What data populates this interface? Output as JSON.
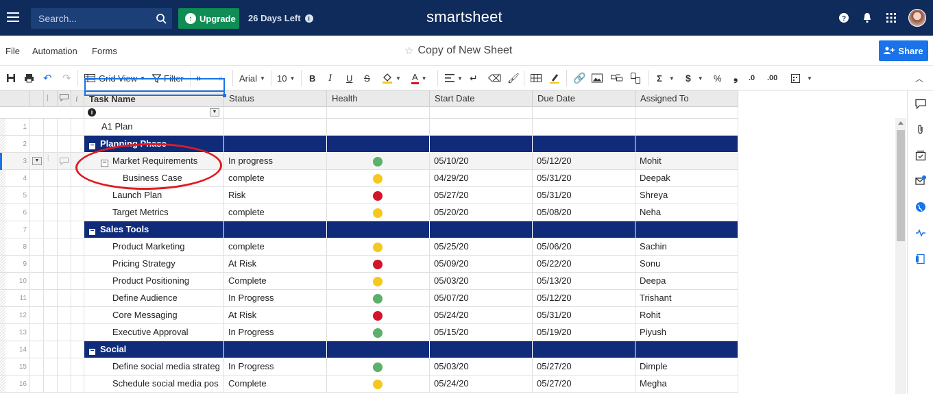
{
  "nav": {
    "search_placeholder": "Search...",
    "upgrade_label": "Upgrade",
    "days_left": "26 Days Left",
    "brand": "smartsheet"
  },
  "menu": {
    "file": "File",
    "automation": "Automation",
    "forms": "Forms",
    "sheet_title": "Copy of New Sheet",
    "share": "Share"
  },
  "toolbar": {
    "grid_view": "Grid View",
    "filter": "Filter",
    "font": "Arial",
    "font_size": "10",
    "bold": "B",
    "italic": "I",
    "underline": "U",
    "strike": "S",
    "text_color": "A",
    "sum": "Σ",
    "currency": "$",
    "percent": "%",
    "thousands": "❟",
    "dec_less": ".0",
    "dec_more": ".00"
  },
  "columns": [
    "Task Name",
    "Status",
    "Health",
    "Start Date",
    "Due Date",
    "Assigned To"
  ],
  "health_colors": {
    "green": "#5bb06a",
    "yellow": "#f5c81d",
    "red": "#d3142a"
  },
  "rows": [
    {
      "num": "1",
      "task": "A1 Plan",
      "status": "",
      "health": "",
      "start": "",
      "due": "",
      "assigned": ""
    },
    {
      "num": "2",
      "task": "Planning Phase",
      "group": true
    },
    {
      "num": "3",
      "task": "Market Requirements",
      "status": "In progress",
      "health": "green",
      "start": "05/10/20",
      "due": "05/12/20",
      "assigned": "Mohit"
    },
    {
      "num": "4",
      "task": "Business Case",
      "status": "complete",
      "health": "yellow",
      "start": "04/29/20",
      "due": "05/31/20",
      "assigned": "Deepak"
    },
    {
      "num": "5",
      "task": "Launch Plan",
      "status": "Risk",
      "health": "red",
      "start": "05/27/20",
      "due": "05/31/20",
      "assigned": "Shreya"
    },
    {
      "num": "6",
      "task": "Target Metrics",
      "status": "complete",
      "health": "yellow",
      "start": "05/20/20",
      "due": "05/08/20",
      "assigned": "Neha"
    },
    {
      "num": "7",
      "task": "Sales Tools",
      "group": true
    },
    {
      "num": "8",
      "task": "Product Marketing",
      "status": "complete",
      "health": "yellow",
      "start": "05/25/20",
      "due": "05/06/20",
      "assigned": "Sachin"
    },
    {
      "num": "9",
      "task": "Pricing Strategy",
      "status": "At Risk",
      "health": "red",
      "start": "05/09/20",
      "due": "05/22/20",
      "assigned": "Sonu"
    },
    {
      "num": "10",
      "task": "Product Positioning",
      "status": "Complete",
      "health": "yellow",
      "start": "05/03/20",
      "due": "05/13/20",
      "assigned": "Deepa"
    },
    {
      "num": "11",
      "task": "Define Audience",
      "status": "In Progress",
      "health": "green",
      "start": "05/07/20",
      "due": "05/12/20",
      "assigned": "Trishant"
    },
    {
      "num": "12",
      "task": "Core Messaging",
      "status": "At Risk",
      "health": "red",
      "start": "05/24/20",
      "due": "05/31/20",
      "assigned": "Rohit"
    },
    {
      "num": "13",
      "task": "Executive Approval",
      "status": "In Progress",
      "health": "green",
      "start": "05/15/20",
      "due": "05/19/20",
      "assigned": "Piyush"
    },
    {
      "num": "14",
      "task": "Social",
      "group": true
    },
    {
      "num": "15",
      "task": "Define social media strateg",
      "status": "In Progress",
      "health": "green",
      "start": "05/03/20",
      "due": "05/27/20",
      "assigned": "Dimple"
    },
    {
      "num": "16",
      "task": "Schedule social media pos",
      "status": "Complete",
      "health": "yellow",
      "start": "05/24/20",
      "due": "05/27/20",
      "assigned": "Megha"
    }
  ]
}
